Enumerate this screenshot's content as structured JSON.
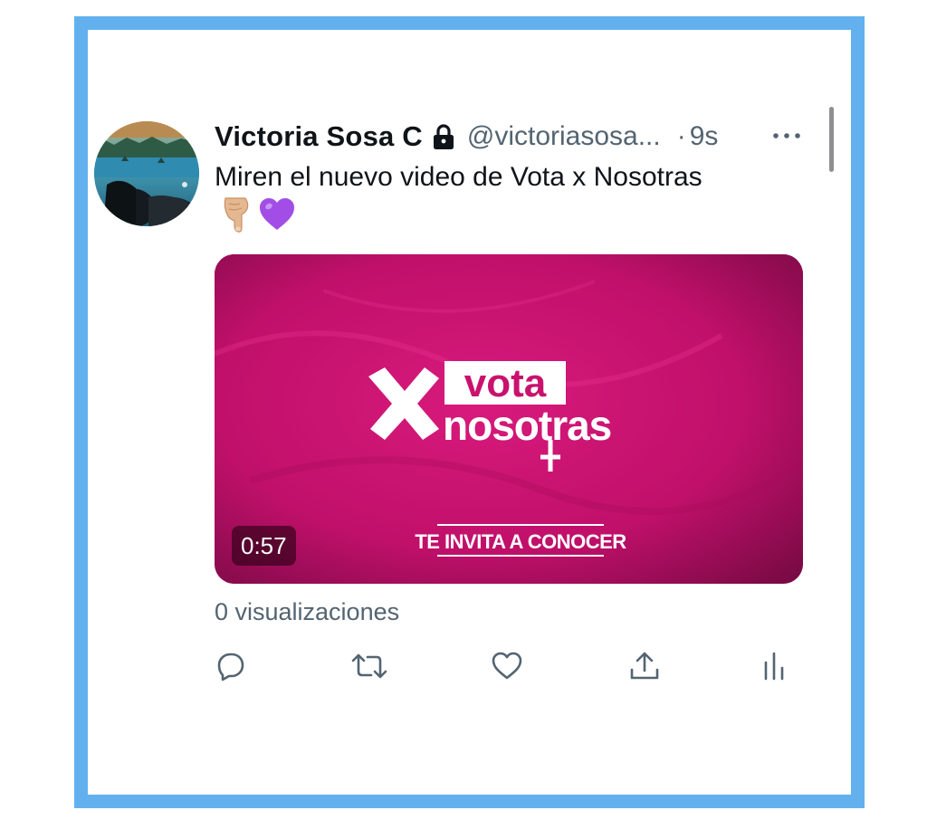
{
  "tweet": {
    "display_name": "Victoria Sosa C",
    "handle": "@victoriasosa...",
    "separator": "·",
    "time": "9s",
    "text": "Miren el nuevo video de Vota x Nosotras",
    "emojis": [
      "👇🏼",
      "💜"
    ],
    "protected": true
  },
  "media": {
    "logo_top": "vota",
    "logo_bottom": "nosotras",
    "tagline": "TE INVITA A CONOCER",
    "duration": "0:57",
    "background_color": "#c8126e"
  },
  "stats": {
    "views": "0 visualizaciones"
  },
  "actions": [
    "reply-icon",
    "retweet-icon",
    "like-icon",
    "share-icon",
    "analytics-icon"
  ],
  "colors": {
    "frame": "#62b1ee",
    "text_primary": "#0f1419",
    "text_secondary": "#536471",
    "media_bg": "#c8126e"
  }
}
